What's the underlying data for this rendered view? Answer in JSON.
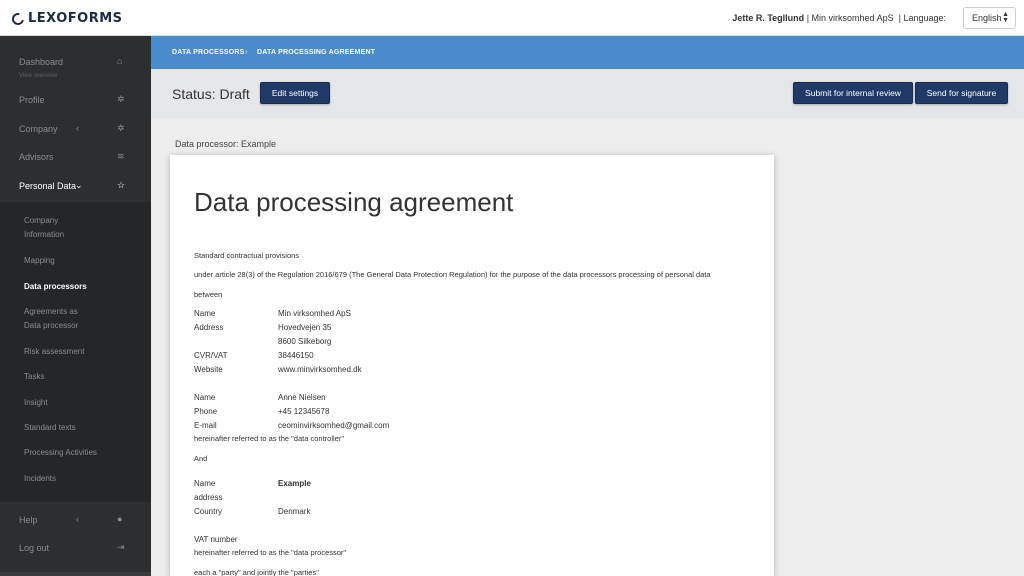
{
  "brand": {
    "logo_text": "LEXOFORMS"
  },
  "header": {
    "user_name": "Jette R. Tegllund",
    "separator": "|",
    "company": "Min virksomhed ApS",
    "language_label": "| Language:",
    "language_value": "English"
  },
  "sidebar": {
    "items": [
      {
        "label": "Dashboard",
        "icon": "home-icon",
        "glyph": "⌂"
      },
      {
        "label": "Profile",
        "icon": "gear-icon",
        "glyph": "✲"
      },
      {
        "label": "Company",
        "icon": "gear-icon",
        "glyph": "✲",
        "chevron": "‹"
      },
      {
        "label": "Advisors",
        "icon": "graduation-cap-icon",
        "glyph": "≋"
      },
      {
        "label": "Personal Data",
        "icon": "star-icon",
        "glyph": "☆",
        "chevron": "⌄"
      },
      {
        "label": "Help",
        "icon": "help-icon",
        "glyph": "●",
        "chevron": "‹"
      },
      {
        "label": "Log out",
        "icon": "logout-icon",
        "glyph": "⇥"
      }
    ],
    "note": "View overview",
    "sub_items": [
      "Company\nInformation",
      "Mapping",
      "Data processors",
      "Agreements as\nData processor",
      "Risk assessment",
      "Tasks",
      "Insight",
      "Standard texts",
      "Processing Activities",
      "Incidents"
    ]
  },
  "breadcrumb": {
    "items": [
      "DATA PROCESSORS",
      "DATA PROCESSING AGREEMENT"
    ],
    "separator": "›"
  },
  "status": {
    "title": "Status: Draft",
    "edit_button": "Edit settings",
    "submit_button": "Submit for internal review",
    "sign_button": "Send for signature"
  },
  "document": {
    "processor_label": "Data processor: Example",
    "title": "Data processing agreement",
    "intro1": "Standard contractual provisions",
    "intro2": "under article 28(3) of the Regulation 2016/679 (The General Data Protection Regulation) for the purpose of the data processors processing of personal data",
    "between": "between",
    "controller": {
      "name_key": "Name",
      "name_val": "Min virksomhed ApS",
      "address_key": "Address",
      "address_val1": "Hovedvejen 35",
      "address_val2": "8600 Silkeborg",
      "cvr_key": "CVR/VAT",
      "cvr_val": "38446150",
      "website_key": "Website",
      "website_val": "www.minvirksomhed.dk",
      "contact_name_key": "Name",
      "contact_name_val": "Anne Nielsen",
      "phone_key": "Phone",
      "phone_val": "+45 12345678",
      "email_key": "E-mail",
      "email_val": "ceominvirksomhed@gmail.com",
      "referred": "hereinafter referred to as the \"data controller\""
    },
    "and": "And",
    "processor": {
      "name_key": "Name",
      "name_val": "Example",
      "address_key": "address",
      "country_key": "Country",
      "country_val": "Denmark",
      "vat_key": "VAT number",
      "referred": "hereinafter referred to as the \"data processor\""
    },
    "parties": "each a \"party\" and jointly the \"parties\""
  }
}
